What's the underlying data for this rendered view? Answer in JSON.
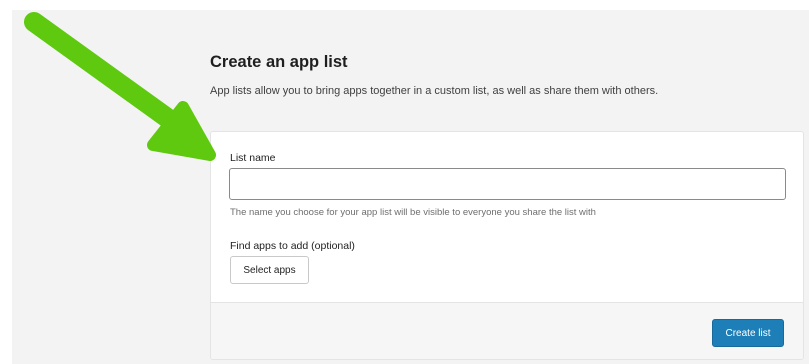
{
  "header": {
    "title": "Create an app list",
    "subtitle": "App lists allow you to bring apps together in a custom list, as well as share them with others."
  },
  "form": {
    "list_name_label": "List name",
    "list_name_value": "",
    "list_name_help": "The name you choose for your app list will be visible to everyone you share the list with",
    "find_apps_label": "Find apps to add (optional)",
    "select_apps_label": "Select apps"
  },
  "footer": {
    "create_list_label": "Create list"
  },
  "colors": {
    "page_background": "#f3f3f3",
    "card_background": "#ffffff",
    "primary_button": "#1e7fb8",
    "annotation_arrow": "#5ec90f"
  },
  "annotation": {
    "icon": "green-arrow-icon"
  }
}
